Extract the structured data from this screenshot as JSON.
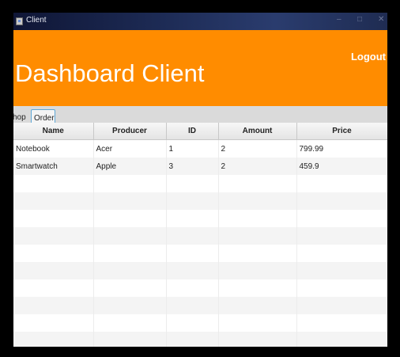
{
  "window": {
    "title": "Client",
    "controls": [
      "–",
      "□",
      "✕"
    ]
  },
  "header": {
    "title": "Dashboard Client",
    "logout_label": "Logout"
  },
  "tabs": [
    {
      "label": "Shop",
      "visible_text": "hop",
      "selected": false
    },
    {
      "label": "Order",
      "selected": true
    }
  ],
  "table": {
    "columns": [
      "Name",
      "Producer",
      "ID",
      "Amount",
      "Price"
    ],
    "rows": [
      [
        "Notebook",
        "Acer",
        "1",
        "2",
        "799.99"
      ],
      [
        "Smartwatch",
        "Apple",
        "3",
        "2",
        "459.9"
      ]
    ]
  },
  "colors": {
    "accent": "#ff8c00",
    "selected_tab_border": "#5fa8d6"
  }
}
